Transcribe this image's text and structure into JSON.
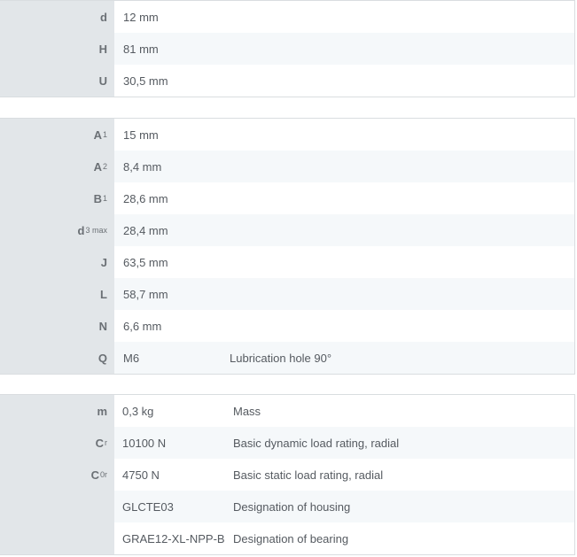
{
  "table1": [
    {
      "sym": "d",
      "sub": "",
      "value": "12  mm",
      "desc": ""
    },
    {
      "sym": "H",
      "sub": "",
      "value": "81  mm",
      "desc": ""
    },
    {
      "sym": "U",
      "sub": "",
      "value": "30,5  mm",
      "desc": ""
    }
  ],
  "table2": [
    {
      "sym": "A",
      "sub": "1",
      "value": "15  mm",
      "desc": ""
    },
    {
      "sym": "A",
      "sub": "2",
      "value": "8,4  mm",
      "desc": ""
    },
    {
      "sym": "B",
      "sub": "1",
      "value": "28,6  mm",
      "desc": ""
    },
    {
      "sym": "d",
      "sub": "3 max",
      "value": "28,4  mm",
      "desc": ""
    },
    {
      "sym": "J",
      "sub": "",
      "value": "63,5  mm",
      "desc": ""
    },
    {
      "sym": "L",
      "sub": "",
      "value": "58,7  mm",
      "desc": ""
    },
    {
      "sym": "N",
      "sub": "",
      "value": "6,6  mm",
      "desc": ""
    },
    {
      "sym": "Q",
      "sub": "",
      "value": "M6",
      "desc": "Lubrication hole 90°"
    }
  ],
  "table3": [
    {
      "sym": "m",
      "sub": "",
      "value": "0,3  kg",
      "desc": "Mass"
    },
    {
      "sym": "C",
      "sub": "r",
      "value": "10100  N",
      "desc": "Basic dynamic load rating, radial"
    },
    {
      "sym": "C",
      "sub": "0r",
      "value": "4750  N",
      "desc": "Basic static load rating, radial"
    },
    {
      "sym": "",
      "sub": "",
      "value": "GLCTE03",
      "desc": "Designation of housing"
    },
    {
      "sym": "",
      "sub": "",
      "value": "GRAE12-XL-NPP-B",
      "desc": "Designation of bearing"
    }
  ]
}
